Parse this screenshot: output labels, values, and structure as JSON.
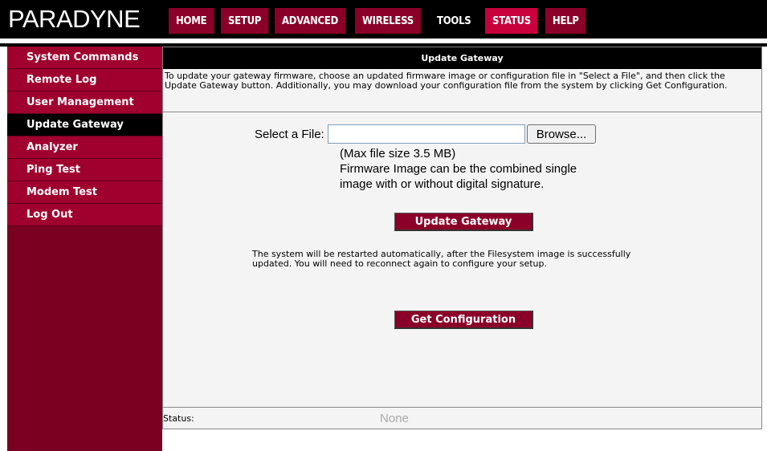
{
  "brand": {
    "logo_text": "PARADYNE"
  },
  "nav": {
    "tabs": [
      {
        "label": "HOME",
        "state": "normal"
      },
      {
        "label": "SETUP",
        "state": "normal"
      },
      {
        "label": "ADVANCED",
        "state": "normal"
      },
      {
        "label": "WIRELESS",
        "state": "normal"
      },
      {
        "label": "TOOLS",
        "state": "active"
      },
      {
        "label": "STATUS",
        "state": "accent"
      },
      {
        "label": "HELP",
        "state": "normal"
      }
    ]
  },
  "sidebar": {
    "items": [
      {
        "label": "System Commands",
        "active": false
      },
      {
        "label": "Remote Log",
        "active": false
      },
      {
        "label": "User Management",
        "active": false
      },
      {
        "label": "Update Gateway",
        "active": true
      },
      {
        "label": "Analyzer",
        "active": false
      },
      {
        "label": "Ping Test",
        "active": false
      },
      {
        "label": "Modem Test",
        "active": false
      },
      {
        "label": "Log Out",
        "active": false
      }
    ]
  },
  "main": {
    "title": "Update Gateway",
    "intro": "To update your gateway firmware, choose an updated firmware image or configuration file in \"Select a File\", and then click the Update Gateway button. Additionally, you may download your configuration file from the system by clicking Get Configuration.",
    "file_label": "Select a File:",
    "file_value": "",
    "browse_label": "Browse...",
    "max_size_note": "(Max file size 3.5 MB)",
    "firmware_note_1": "Firmware Image can be the combined single",
    "firmware_note_2": "image with or without digital signature.",
    "update_button": "Update Gateway",
    "restart_note": "The system will be restarted automatically, after the Filesystem image is successfully updated. You will need to reconnect again to configure your setup.",
    "get_config_button": "Get Configuration",
    "status_label": "Status:",
    "status_value": "None"
  },
  "colors": {
    "brand_red": "#8b0028",
    "accent_red": "#c8003c",
    "sidebar_red": "#a0002e",
    "black": "#000000"
  }
}
